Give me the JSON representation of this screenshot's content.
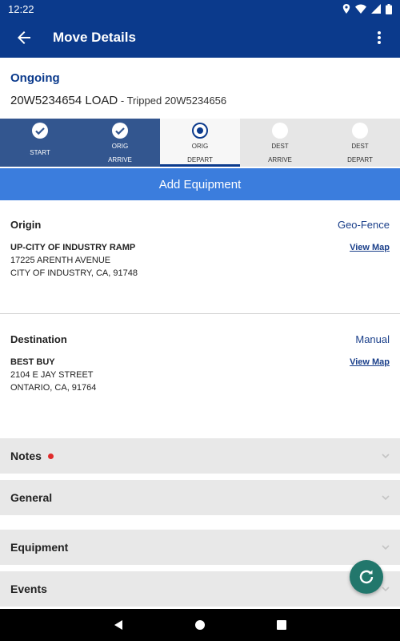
{
  "status_bar": {
    "time": "12:22"
  },
  "app_bar": {
    "title": "Move Details"
  },
  "move": {
    "status": "Ongoing",
    "load_number": "20W5234654 LOAD",
    "tripped_text": " - Tripped 20W5234656"
  },
  "stepper": [
    {
      "line1": "START",
      "line2": "",
      "state": "done"
    },
    {
      "line1": "ORIG",
      "line2": "ARRIVE",
      "state": "done"
    },
    {
      "line1": "ORIG",
      "line2": "DEPART",
      "state": "current"
    },
    {
      "line1": "DEST",
      "line2": "ARRIVE",
      "state": "pending"
    },
    {
      "line1": "DEST",
      "line2": "DEPART",
      "state": "pending"
    }
  ],
  "add_equipment_label": "Add Equipment",
  "origin": {
    "heading": "Origin",
    "mode": "Geo-Fence",
    "name": "UP-CITY OF INDUSTRY RAMP",
    "address1": "17225 ARENTH AVENUE",
    "address2": "CITY OF INDUSTRY, CA, 91748",
    "view_map": "View Map"
  },
  "destination": {
    "heading": "Destination",
    "mode": "Manual",
    "name": "BEST BUY",
    "address1": "2104  E JAY STREET",
    "address2": "ONTARIO, CA, 91764",
    "view_map": "View Map"
  },
  "sections": {
    "notes": "Notes",
    "general": "General",
    "equipment": "Equipment",
    "events": "Events"
  },
  "colors": {
    "primary": "#0b3a8c",
    "step_done": "#33568f",
    "accent_button": "#3b7ddd",
    "fab": "#22776c",
    "notes_indicator": "#e02b2b"
  },
  "icons": {
    "back": "back-arrow-icon",
    "menu": "more-vert-icon",
    "refresh": "refresh-icon",
    "chevron": "chevron-down-icon"
  }
}
